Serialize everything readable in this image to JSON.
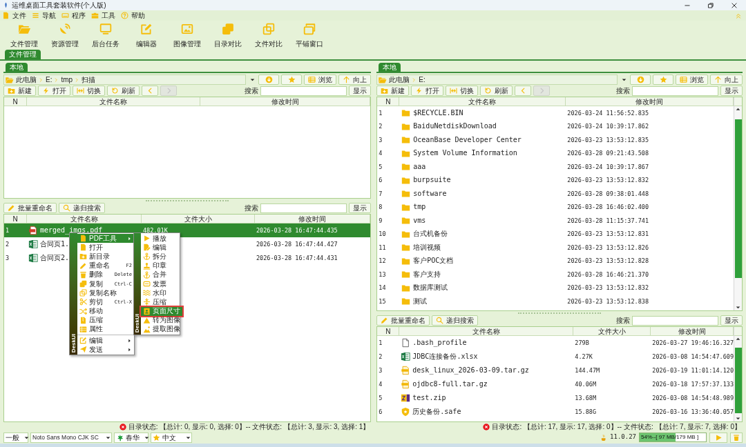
{
  "window": {
    "title": "运维桌面工具套装软件(个人版)"
  },
  "menu": [
    {
      "label": "文件",
      "kind": "file"
    },
    {
      "label": "导航",
      "kind": "nav"
    },
    {
      "label": "程序",
      "kind": "program"
    },
    {
      "label": "工具",
      "kind": "tools"
    },
    {
      "label": "帮助",
      "kind": "help"
    }
  ],
  "toolbar": [
    {
      "label": "文件管理",
      "kind": "files"
    },
    {
      "label": "资源管理",
      "kind": "resources"
    },
    {
      "label": "后台任务",
      "kind": "tasks"
    },
    {
      "label": "编辑器",
      "kind": "editor"
    },
    {
      "label": "图像管理",
      "kind": "images"
    },
    {
      "label": "目录对比",
      "kind": "dir_compare"
    },
    {
      "label": "文件对比",
      "kind": "file_compare"
    },
    {
      "label": "平铺窗口",
      "kind": "tile"
    }
  ],
  "main_tabs": [
    {
      "label": "文件管理",
      "selected": true
    }
  ],
  "panes": [
    {
      "tab": {
        "label": "本地",
        "selected": true
      },
      "path": [
        "此电脑",
        "E:",
        "tmp",
        "扫描"
      ],
      "browse_button": "浏览",
      "up_button": "向上",
      "actions": [
        {
          "label": "新建",
          "kind": "new"
        },
        {
          "label": "打开",
          "kind": "open"
        },
        {
          "label": "切换",
          "kind": "switch"
        },
        {
          "label": "刷新",
          "kind": "refresh"
        }
      ],
      "history": [
        {
          "kind": "back",
          "disabled": false
        },
        {
          "kind": "forward",
          "disabled": true
        }
      ],
      "dir_search": {
        "label": "搜索",
        "button": "显示"
      },
      "dir_table": {
        "columns": [
          "N",
          "文件名称",
          "修改时间"
        ]
      },
      "file_tools": [
        {
          "label": "批量重命名",
          "kind": "rename"
        },
        {
          "label": "递归搜索",
          "kind": "search"
        }
      ],
      "file_search": {
        "label": "搜索",
        "button": "显示"
      },
      "file_table": {
        "columns": [
          "N",
          "文件名称",
          "文件大小",
          "修改时间"
        ],
        "rows": [
          {
            "n": "1",
            "name": "merged_imgs.pdf",
            "size": "482.01K",
            "time": "2026-03-28 16:47:44.435",
            "kind": "pdf",
            "selected": true
          },
          {
            "n": "2",
            "name": "合同页1.",
            "time": "2026-03-28 16:47:44.427",
            "kind": "sheet",
            "selected": false
          },
          {
            "n": "3",
            "name": "合同页2.",
            "time": "2026-03-28 16:47:44.431",
            "kind": "sheet",
            "selected": false
          }
        ]
      },
      "status": "目录状态: 【总计: 0, 显示: 0, 选择: 0】-- 文件状态: 【总计: 3, 显示: 3, 选择: 1】"
    },
    {
      "tab": {
        "label": "本地",
        "selected": true
      },
      "path": [
        "此电脑",
        "E:"
      ],
      "browse_button": "浏览",
      "up_button": "向上",
      "actions": [
        {
          "label": "新建",
          "kind": "new"
        },
        {
          "label": "打开",
          "kind": "open"
        },
        {
          "label": "切换",
          "kind": "switch"
        },
        {
          "label": "刷新",
          "kind": "refresh"
        }
      ],
      "history": [
        {
          "kind": "back",
          "disabled": false
        },
        {
          "kind": "forward",
          "disabled": true
        }
      ],
      "dir_search": {
        "label": "搜索",
        "button": "显示"
      },
      "dir_table": {
        "columns": [
          "N",
          "文件名称",
          "修改时间"
        ],
        "rows": [
          {
            "n": "1",
            "name": "$RECYCLE.BIN",
            "time": "2026-03-24 11:56:52.835",
            "selected": false
          },
          {
            "n": "2",
            "name": "BaiduNetdiskDownload",
            "time": "2026-03-24 10:39:17.862",
            "selected": false
          },
          {
            "n": "3",
            "name": "OceanBase Developer Center",
            "time": "2026-03-23 13:53:12.835",
            "selected": false
          },
          {
            "n": "4",
            "name": "System Volume Information",
            "time": "2026-03-28 09:21:43.508",
            "selected": false
          },
          {
            "n": "5",
            "name": "aaa",
            "time": "2026-03-24 10:39:17.867",
            "selected": false
          },
          {
            "n": "6",
            "name": "burpsuite",
            "time": "2026-03-23 13:53:12.832",
            "selected": false
          },
          {
            "n": "7",
            "name": "software",
            "time": "2026-03-28 09:38:01.448",
            "selected": false
          },
          {
            "n": "8",
            "name": "tmp",
            "time": "2026-03-28 16:46:02.400",
            "selected": false
          },
          {
            "n": "9",
            "name": "vms",
            "time": "2026-03-28 11:15:37.741",
            "selected": false
          },
          {
            "n": "10",
            "name": "台式机备份",
            "time": "2026-03-23 13:53:12.831",
            "selected": false
          },
          {
            "n": "11",
            "name": "培训视频",
            "time": "2026-03-23 13:53:12.826",
            "selected": false
          },
          {
            "n": "12",
            "name": "客户POC文档",
            "time": "2026-03-23 13:53:12.828",
            "selected": false
          },
          {
            "n": "13",
            "name": "客户支持",
            "time": "2026-03-28 16:46:21.370",
            "selected": false
          },
          {
            "n": "14",
            "name": "数据库测试",
            "time": "2026-03-23 13:53:12.832",
            "selected": false
          },
          {
            "n": "15",
            "name": "测试",
            "time": "2026-03-23 13:53:12.838",
            "selected": false
          }
        ]
      },
      "file_tools": [
        {
          "label": "批量重命名",
          "kind": "rename"
        },
        {
          "label": "递归搜索",
          "kind": "search"
        }
      ],
      "file_search": {
        "label": "搜索",
        "button": "显示"
      },
      "file_table": {
        "columns": [
          "N",
          "文件名称",
          "文件大小",
          "修改时间"
        ],
        "rows": [
          {
            "n": "1",
            "name": ".bash_profile",
            "size": "279B",
            "time": "2026-03-27 19:46:16.327",
            "kind": "text",
            "selected": false
          },
          {
            "n": "2",
            "name": "JDBC连接备份.xlsx",
            "size": "4.27K",
            "time": "2026-03-08 14:54:47.609",
            "kind": "sheet",
            "selected": false
          },
          {
            "n": "3",
            "name": "desk_linux_2026-03-09.tar.gz",
            "size": "144.47M",
            "time": "2026-03-19 11:01:14.120",
            "kind": "gzip",
            "selected": false
          },
          {
            "n": "4",
            "name": "ojdbc8-full.tar.gz",
            "size": "40.06M",
            "time": "2026-03-18 17:57:37.133",
            "kind": "gzip",
            "selected": false
          },
          {
            "n": "5",
            "name": "test.zip",
            "size": "13.68M",
            "time": "2026-03-08 14:54:48.989",
            "kind": "zip",
            "selected": false
          },
          {
            "n": "6",
            "name": "历史备份.safe",
            "size": "15.88G",
            "time": "2026-03-16 13:36:40.057",
            "kind": "safe",
            "selected": false
          }
        ]
      },
      "status": "目录状态: 【总计: 17, 显示: 17, 选择: 0】-- 文件状态: 【总计: 7, 显示: 7, 选择: 0】"
    }
  ],
  "context_menu": {
    "sidebar": "DeskUI",
    "items": [
      {
        "label": "PDF工具",
        "kind": "pdf_tools",
        "submenu": true,
        "selected": true
      },
      {
        "label": "打开",
        "kind": "open",
        "submenu": false,
        "selected": false
      },
      {
        "label": "新目录",
        "kind": "new_folder",
        "submenu": false,
        "selected": false
      },
      {
        "label": "重命名",
        "kind": "rename",
        "shortcut": "F2",
        "submenu": false,
        "selected": false
      },
      {
        "label": "删除",
        "kind": "delete",
        "shortcut": "Delete",
        "submenu": false,
        "selected": false
      },
      {
        "label": "复制",
        "kind": "copy",
        "shortcut": "Ctrl-C",
        "submenu": false,
        "selected": false
      },
      {
        "label": "复制名称",
        "kind": "copy_name",
        "submenu": false,
        "selected": false
      },
      {
        "label": "剪切",
        "kind": "cut",
        "shortcut": "Ctrl-X",
        "submenu": false,
        "selected": false
      },
      {
        "label": "移动",
        "kind": "move",
        "submenu": false,
        "selected": false
      },
      {
        "label": "压缩",
        "kind": "compress",
        "submenu": false,
        "selected": false
      },
      {
        "label": "属性",
        "kind": "properties",
        "submenu": false,
        "selected": false
      },
      {
        "kind": "separator"
      },
      {
        "label": "编辑",
        "kind": "edit",
        "submenu": true,
        "selected": false
      },
      {
        "label": "发送",
        "kind": "send",
        "submenu": true,
        "selected": false
      }
    ]
  },
  "submenu": {
    "sidebar": "DeskUI",
    "items": [
      {
        "label": "播放",
        "kind": "play",
        "selected": false
      },
      {
        "label": "编辑",
        "kind": "edit_pdf",
        "selected": false
      },
      {
        "label": "拆分",
        "kind": "split",
        "selected": false
      },
      {
        "label": "印章",
        "kind": "stamp",
        "selected": false
      },
      {
        "label": "合并",
        "kind": "merge",
        "selected": false
      },
      {
        "label": "发票",
        "kind": "invoice",
        "selected": false
      },
      {
        "label": "水印",
        "kind": "watermark",
        "selected": false
      },
      {
        "label": "压缩",
        "kind": "compress_pdf",
        "selected": false
      },
      {
        "label": "页面尺寸",
        "kind": "page_size",
        "selected": true
      },
      {
        "label": "转为图像",
        "kind": "to_image",
        "selected": false
      },
      {
        "label": "提取图像",
        "kind": "extract_image",
        "selected": false
      }
    ]
  },
  "bottom_bar": {
    "selects": [
      {
        "value": "一般"
      },
      {
        "value": "Noto Sans Mono CJK SC"
      },
      {
        "value": "春华",
        "kind": "leaf"
      },
      {
        "value": "中文",
        "kind": "star"
      }
    ],
    "version": "11.0.27",
    "memory": {
      "level": 0.54,
      "reading": "54%--[ 97 MB/179 MB ]"
    }
  }
}
